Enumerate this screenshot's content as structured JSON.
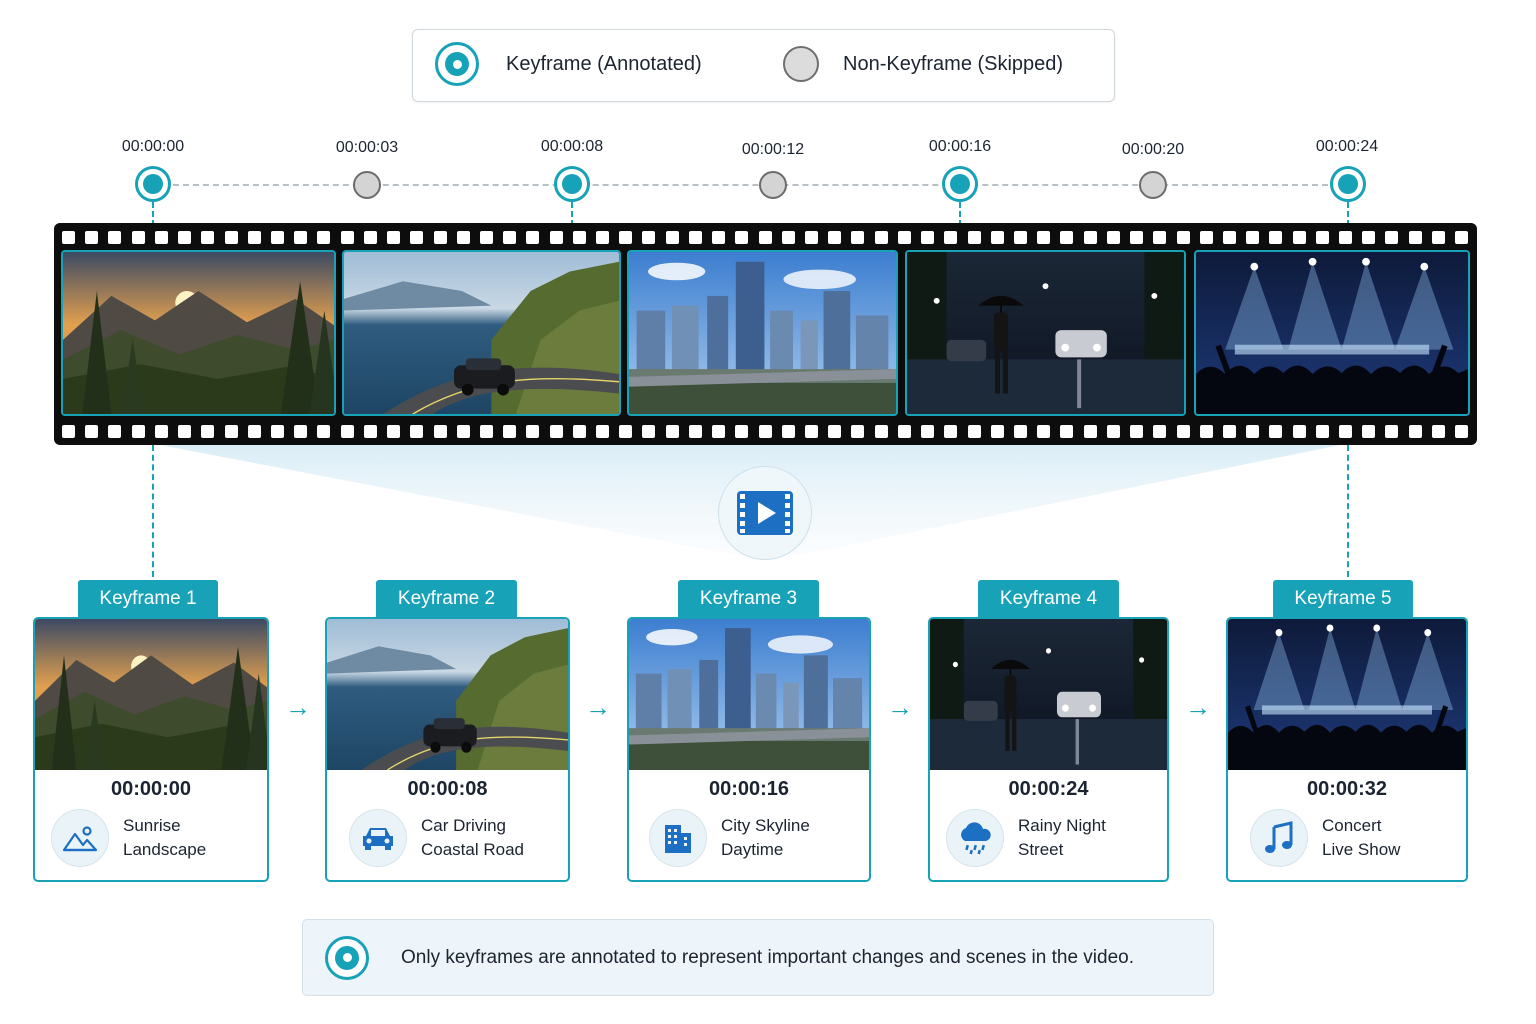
{
  "legend": {
    "keyframe_label": "Keyframe  (Annotated)",
    "non_keyframe_label": "Non-Keyframe  (Skipped)"
  },
  "timeline": {
    "markers": [
      {
        "time": "00:00:00",
        "type": "keyframe"
      },
      {
        "time": "00:00:03",
        "type": "non-keyframe"
      },
      {
        "time": "00:00:08",
        "type": "keyframe"
      },
      {
        "time": "00:00:12",
        "type": "non-keyframe"
      },
      {
        "time": "00:00:16",
        "type": "keyframe"
      },
      {
        "time": "00:00:20",
        "type": "non-keyframe"
      },
      {
        "time": "00:00:24",
        "type": "keyframe"
      }
    ]
  },
  "filmstrip": {
    "frames": [
      "sunrise-landscape",
      "car-coastal-road",
      "city-skyline",
      "rainy-night-street",
      "concert-live-show"
    ]
  },
  "keyframes": [
    {
      "tab": "Keyframe 1",
      "time": "00:00:00",
      "line1": "Sunrise",
      "line2": "Landscape",
      "icon": "landscape-icon"
    },
    {
      "tab": "Keyframe 2",
      "time": "00:00:08",
      "line1": "Car Driving",
      "line2": "Coastal Road",
      "icon": "car-icon"
    },
    {
      "tab": "Keyframe 3",
      "time": "00:00:16",
      "line1": "City Skyline",
      "line2": "Daytime",
      "icon": "building-icon"
    },
    {
      "tab": "Keyframe 4",
      "time": "00:00:24",
      "line1": "Rainy Night",
      "line2": "Street",
      "icon": "rain-cloud-icon"
    },
    {
      "tab": "Keyframe 5",
      "time": "00:00:32",
      "line1": "Concert",
      "line2": "Live Show",
      "icon": "music-note-icon"
    }
  ],
  "note": {
    "text": "Only keyframes are annotated to represent important changes and scenes in the video."
  },
  "colors": {
    "accent": "#17a2b8",
    "film": "#0d0d0d",
    "non_keyframe": "#d4d4d4",
    "icon_blue": "#1c6fc2"
  }
}
